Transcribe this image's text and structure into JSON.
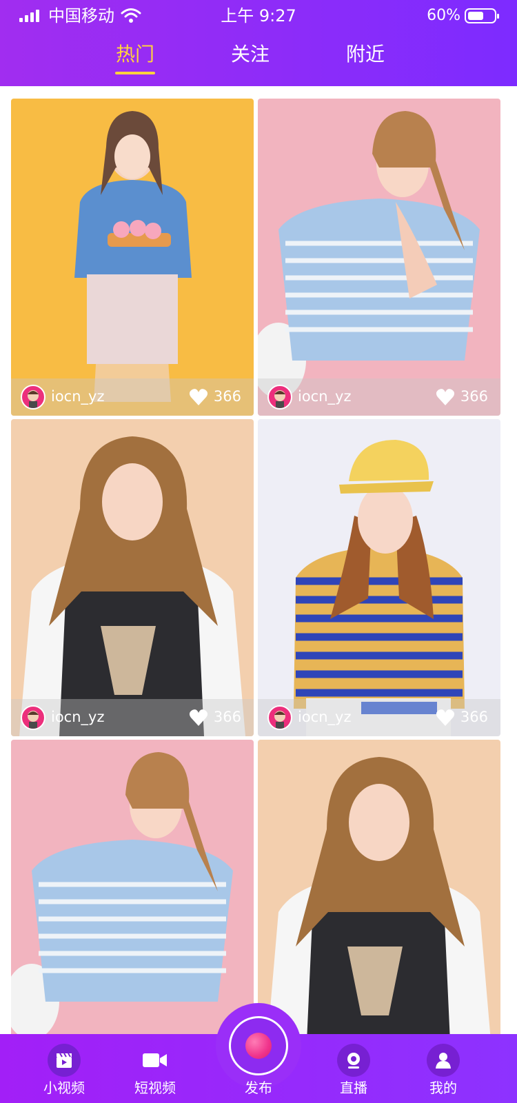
{
  "status_bar": {
    "carrier": "中国移动",
    "time": "上午 9:27",
    "battery_percent": "60%",
    "battery_level": 0.6,
    "icons": [
      "signal-icon",
      "wifi-icon",
      "battery-icon"
    ]
  },
  "tabs": [
    {
      "label": "热门",
      "active": true
    },
    {
      "label": "关注",
      "active": false
    },
    {
      "label": "附近",
      "active": false
    }
  ],
  "feed": {
    "cards": [
      {
        "username": "iocn_yz",
        "likes": "366",
        "photo": "yellow-backdrop"
      },
      {
        "username": "iocn_yz",
        "likes": "366",
        "photo": "pink-backdrop"
      },
      {
        "username": "iocn_yz",
        "likes": "366",
        "photo": "peach-backdrop"
      },
      {
        "username": "iocn_yz",
        "likes": "366",
        "photo": "white-backdrop"
      },
      {
        "username": "",
        "likes": "",
        "photo": "pink-backdrop"
      },
      {
        "username": "",
        "likes": "",
        "photo": "peach-backdrop"
      }
    ]
  },
  "bottom_nav": {
    "items": [
      {
        "label": "小视频",
        "icon": "clapperboard-icon"
      },
      {
        "label": "短视频",
        "icon": "video-camera-icon"
      },
      {
        "label": "直播",
        "icon": "live-icon"
      },
      {
        "label": "我的",
        "icon": "user-icon"
      }
    ],
    "publish_label": "发布"
  },
  "colors": {
    "header_gradient_start": "#a12df0",
    "header_gradient_end": "#7d2bff",
    "active_tab": "#ffd23e",
    "avatar_ring": "#ec2f7c"
  }
}
